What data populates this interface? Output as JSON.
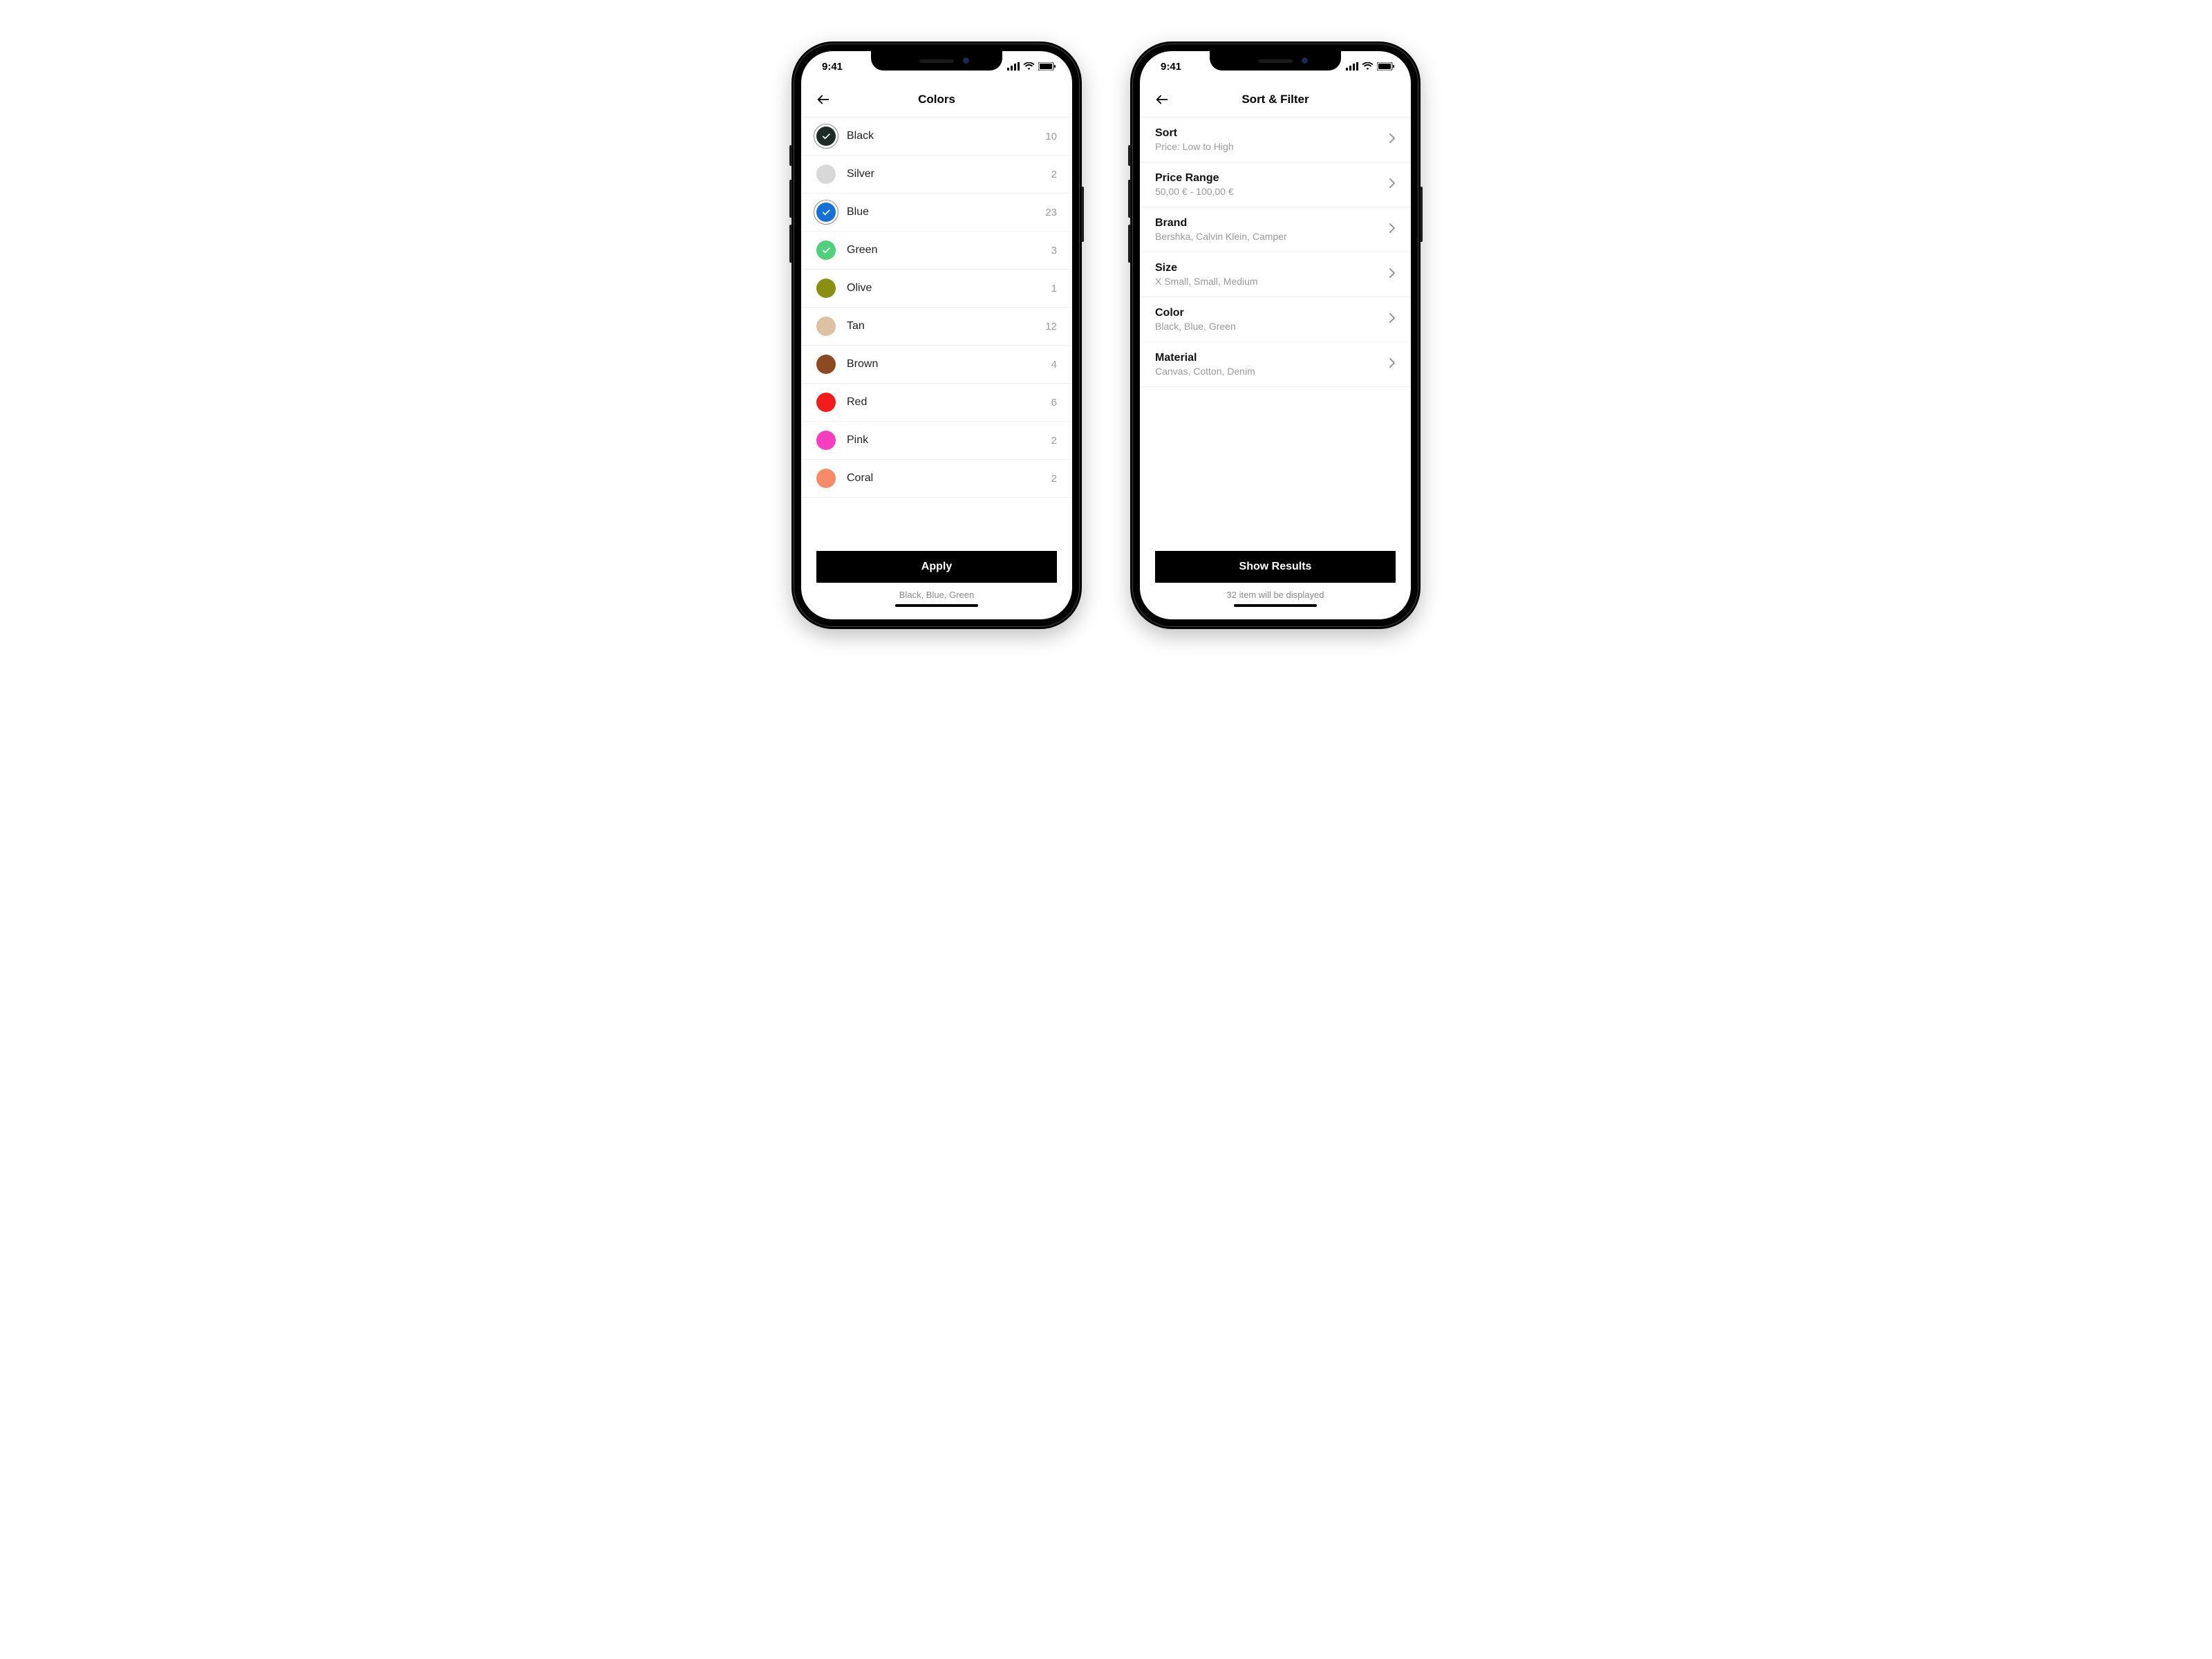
{
  "status": {
    "time": "9:41"
  },
  "screen1": {
    "title": "Colors",
    "colors": [
      {
        "label": "Black",
        "count": "10",
        "hex": "#1f2b27",
        "selected": true,
        "ring": true
      },
      {
        "label": "Silver",
        "count": "2",
        "hex": "#d8d8d8",
        "selected": false,
        "ring": false
      },
      {
        "label": "Blue",
        "count": "23",
        "hex": "#1670d8",
        "selected": true,
        "ring": true
      },
      {
        "label": "Green",
        "count": "3",
        "hex": "#4fd07a",
        "selected": true,
        "ring": false
      },
      {
        "label": "Olive",
        "count": "1",
        "hex": "#8a8f12",
        "selected": false,
        "ring": false
      },
      {
        "label": "Tan",
        "count": "12",
        "hex": "#dcc2a2",
        "selected": false,
        "ring": false
      },
      {
        "label": "Brown",
        "count": "4",
        "hex": "#8c4a21",
        "selected": false,
        "ring": false
      },
      {
        "label": "Red",
        "count": "6",
        "hex": "#f21c1c",
        "selected": false,
        "ring": false
      },
      {
        "label": "Pink",
        "count": "2",
        "hex": "#f73ec1",
        "selected": false,
        "ring": false
      },
      {
        "label": "Coral",
        "count": "2",
        "hex": "#f78b68",
        "selected": false,
        "ring": false
      }
    ],
    "cta": "Apply",
    "summary": "Black, Blue, Green"
  },
  "screen2": {
    "title": "Sort & Filter",
    "filters": [
      {
        "title": "Sort",
        "sub": "Price: Low to High"
      },
      {
        "title": "Price Range",
        "sub": "50,00 € - 100,00 €"
      },
      {
        "title": "Brand",
        "sub": "Bershka, Calvin Klein, Camper"
      },
      {
        "title": "Size",
        "sub": "X Small, Small, Medium"
      },
      {
        "title": "Color",
        "sub": "Black, Blue, Green"
      },
      {
        "title": "Material",
        "sub": "Canvas, Cotton, Denim"
      }
    ],
    "cta": "Show Results",
    "summary": "32 item will be displayed"
  }
}
